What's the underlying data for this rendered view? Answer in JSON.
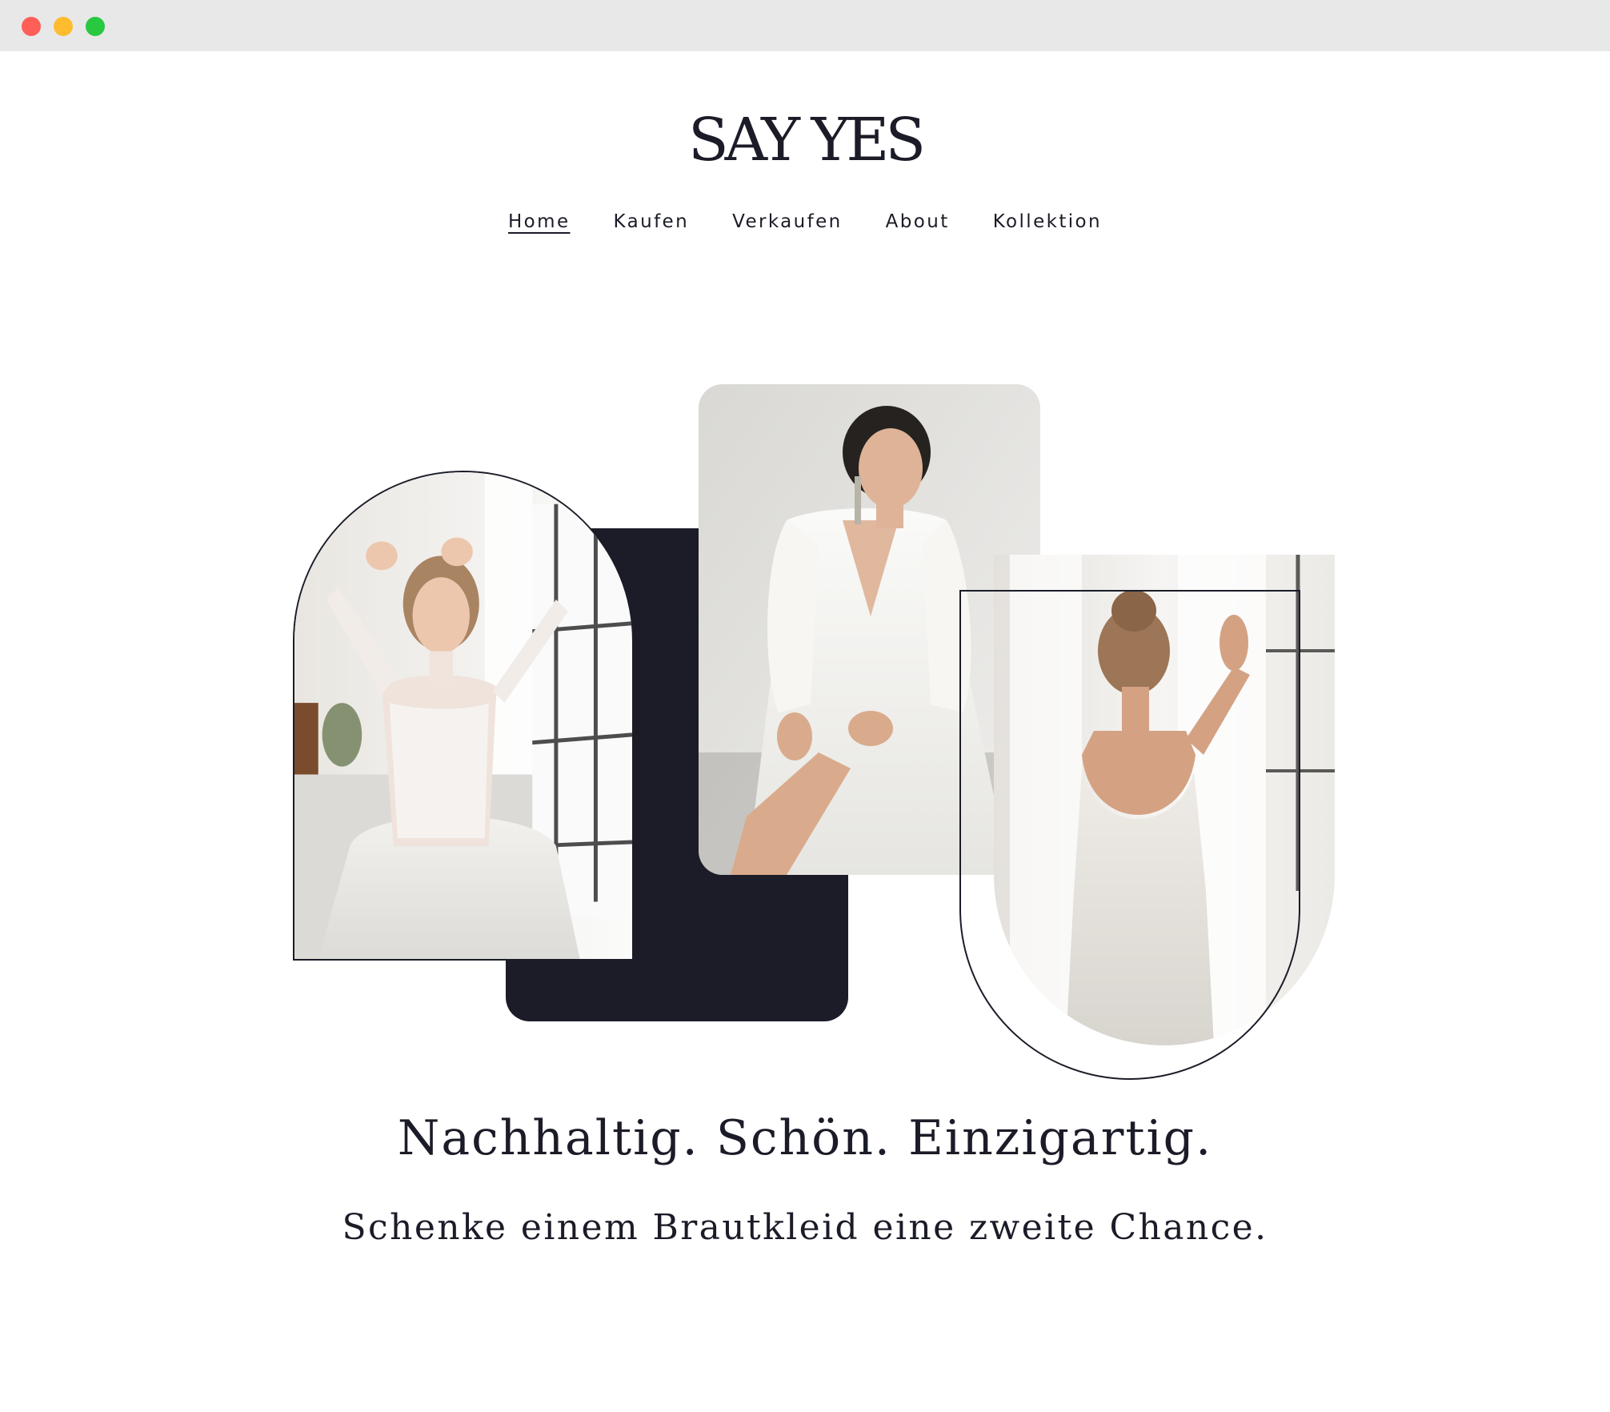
{
  "window": {
    "controls": {
      "close_color": "#ff5f57",
      "minimize_color": "#febc2e",
      "maximize_color": "#28c840"
    }
  },
  "brand": {
    "logo_text": "SAY YES",
    "primary_color": "#1b1c28"
  },
  "nav": {
    "items": [
      {
        "label": "Home",
        "active": true
      },
      {
        "label": "Kaufen",
        "active": false
      },
      {
        "label": "Verkaufen",
        "active": false
      },
      {
        "label": "About",
        "active": false
      },
      {
        "label": "Kollektion",
        "active": false
      }
    ]
  },
  "hero": {
    "images": [
      {
        "name": "bride-lace-dress-window",
        "shape": "arch"
      },
      {
        "name": "bride-seated-v-neck-dress",
        "shape": "rounded-rectangle"
      },
      {
        "name": "bride-open-back-curtain",
        "shape": "inverted-arch"
      }
    ],
    "headline": "Nachhaltig. Schön. Einzigartig.",
    "subline": "Schenke einem Brautkleid eine zweite Chance."
  }
}
